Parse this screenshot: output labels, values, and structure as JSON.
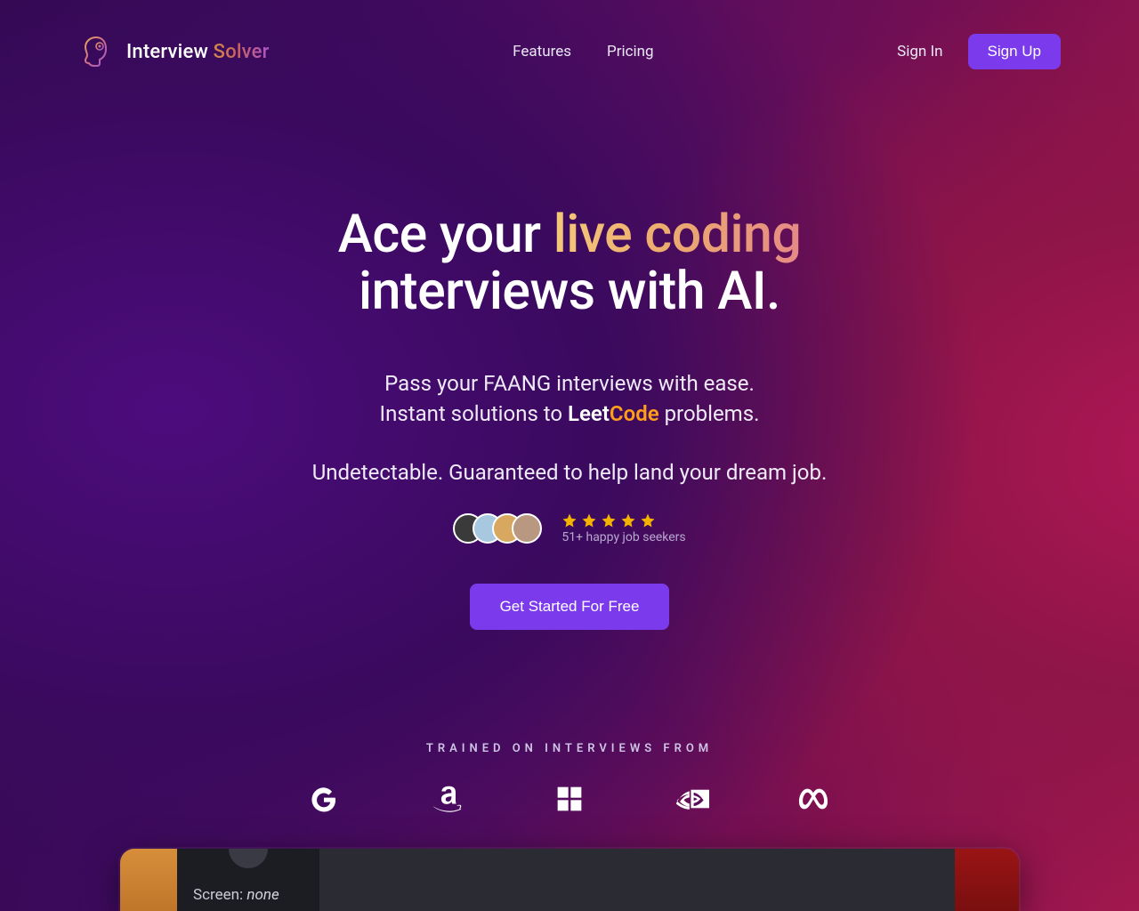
{
  "brand": {
    "name_part1": "Interview ",
    "name_part2": "Solver"
  },
  "nav": {
    "features": "Features",
    "pricing": "Pricing",
    "signin": "Sign In",
    "signup": "Sign Up"
  },
  "hero": {
    "line1_before": "Ace your ",
    "line1_highlight": "live coding",
    "line2": "interviews with AI.",
    "sub_line1": "Pass your FAANG interviews with ease.",
    "sub_line2_before": "Instant solutions to  ",
    "sub_line2_leet": "Leet",
    "sub_line2_code": "Code",
    "sub_line2_after": "  problems.",
    "sub_line3": "Undetectable. Guaranteed to help land your dream job."
  },
  "social": {
    "seekers": "51+ happy job seekers",
    "star_count": 5
  },
  "cta": {
    "label": "Get Started For Free"
  },
  "trained": {
    "label": "TRAINED ON INTERVIEWS FROM",
    "companies": [
      "google",
      "amazon",
      "microsoft",
      "nvidia",
      "meta"
    ]
  },
  "demo": {
    "screen_label": "Screen: ",
    "screen_value": "none"
  },
  "colors": {
    "accent": "#7c3aed",
    "star": "#f5b301",
    "orange": "#ff9e1b"
  }
}
